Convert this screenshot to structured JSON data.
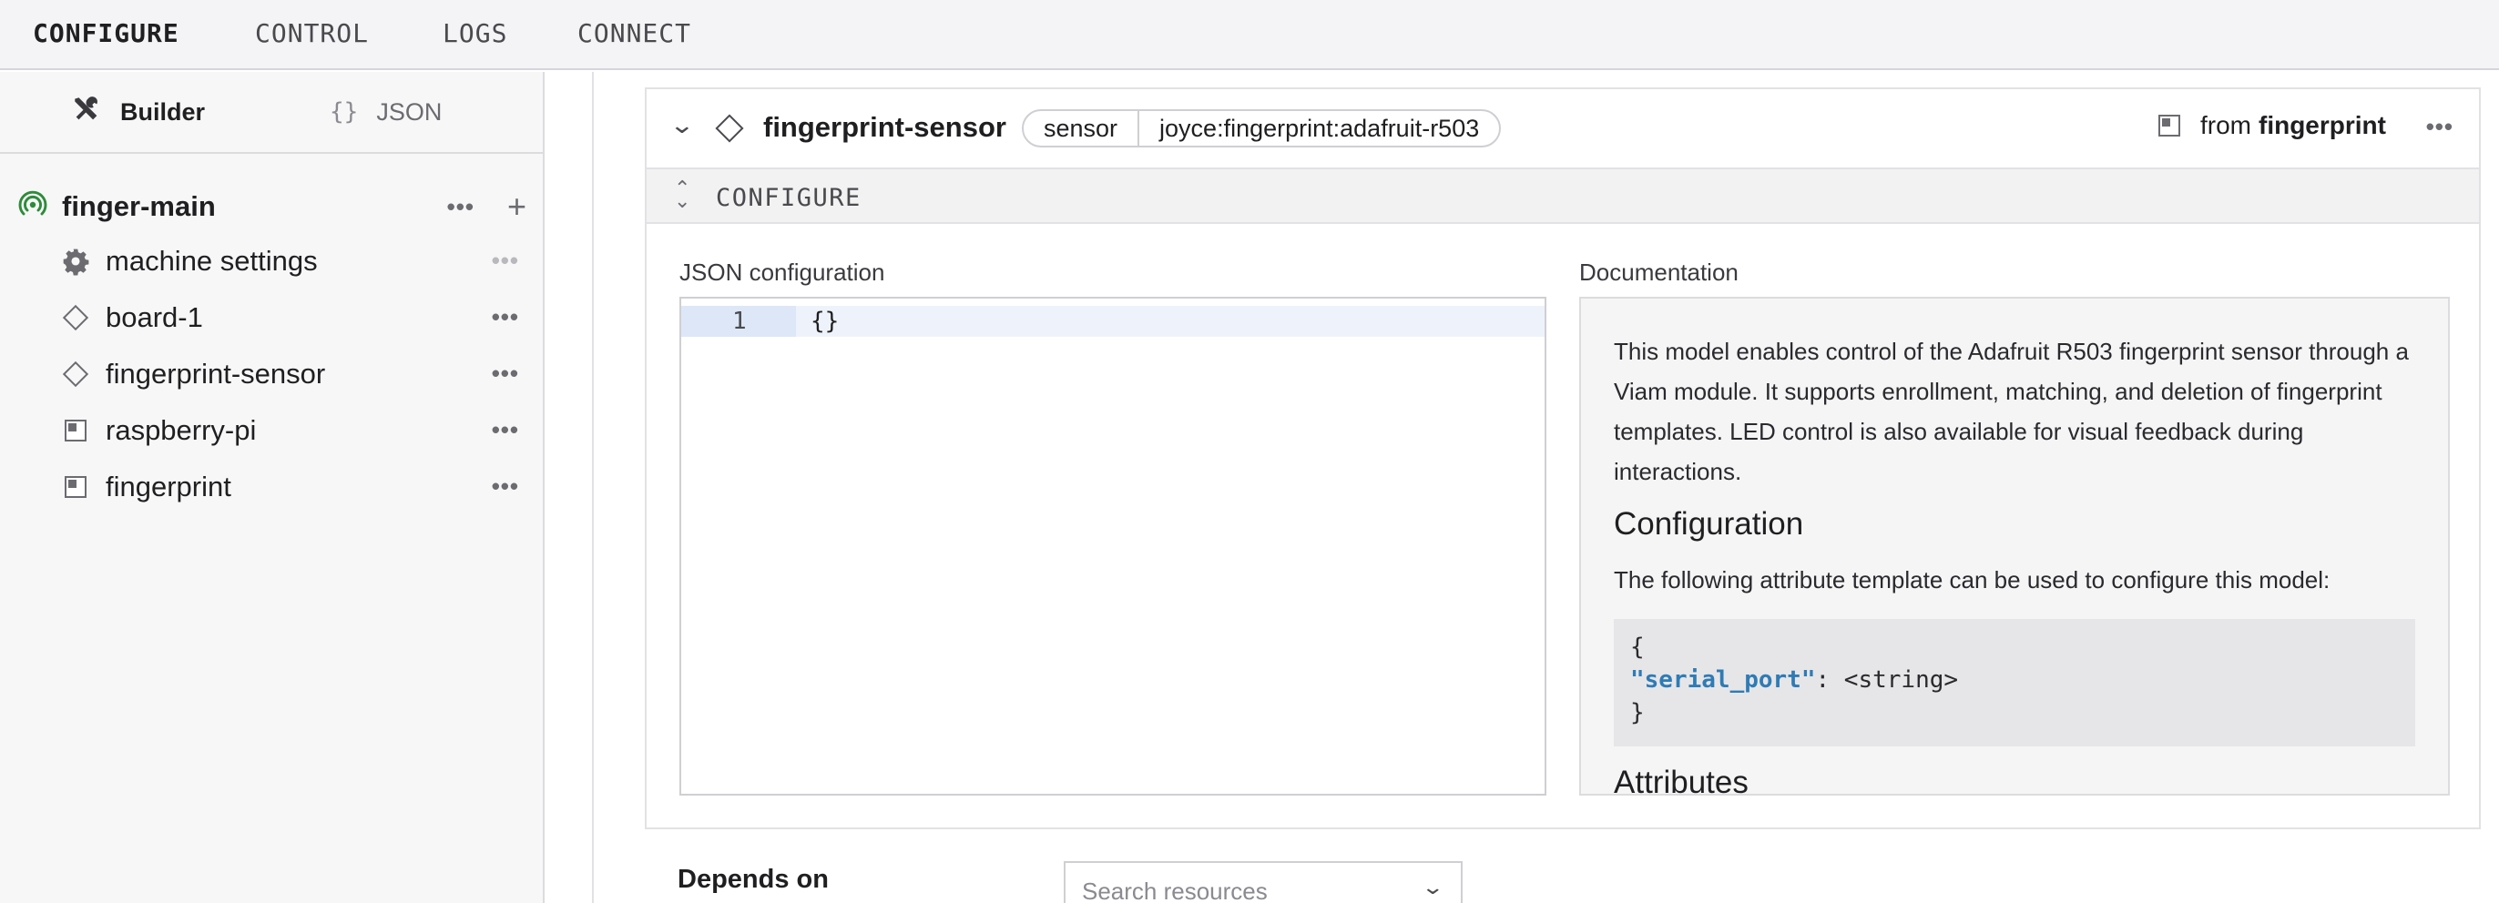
{
  "nav": {
    "tabs": [
      "CONFIGURE",
      "CONTROL",
      "LOGS",
      "CONNECT"
    ],
    "active": "CONFIGURE"
  },
  "sidebar": {
    "tabs": [
      {
        "label": "Builder",
        "icon": "wrench-screwdriver-icon"
      },
      {
        "label": "JSON",
        "icon": "braces-icon",
        "glyph": "{}"
      }
    ],
    "root": {
      "name": "finger-main",
      "status_icon": "online-icon",
      "status_color": "#2e8b3a"
    },
    "items": [
      {
        "label": "machine settings",
        "icon": "gear-icon"
      },
      {
        "label": "board-1",
        "icon": "diamond-icon"
      },
      {
        "label": "fingerprint-sensor",
        "icon": "diamond-icon"
      },
      {
        "label": "raspberry-pi",
        "icon": "module-icon"
      },
      {
        "label": "fingerprint",
        "icon": "module-icon"
      }
    ]
  },
  "component": {
    "name": "fingerprint-sensor",
    "type": "sensor",
    "model": "joyce:fingerprint:adafruit-r503",
    "from_label": "from",
    "from_module": "fingerprint",
    "section_title": "CONFIGURE",
    "json_label": "JSON configuration",
    "json_line_number": "1",
    "json_value": "{}",
    "docs_label": "Documentation",
    "docs_body": "This model enables control of the Adafruit R503 fingerprint sensor through a Viam module. It supports enrollment, matching, and deletion of fingerprint templates. LED control is also available for visual feedback during interactions.",
    "docs_heading": "Configuration",
    "docs_template_text": "The following attribute template can be used to configure this model:",
    "docs_code": {
      "open": "{",
      "key": "\"serial_port\"",
      "rest": ": <string>",
      "close": "}"
    },
    "docs_heading_2": "Attributes"
  },
  "depends": {
    "label": "Depends on",
    "placeholder": "Search resources"
  },
  "colors": {
    "accent": "#2f7bb5",
    "status_online": "#2e8b3a"
  }
}
